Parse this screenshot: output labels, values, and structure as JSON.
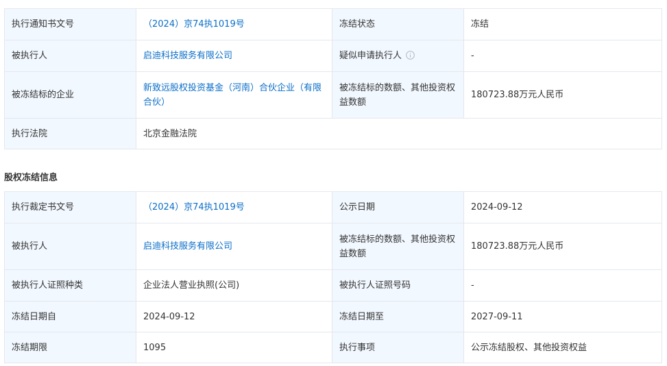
{
  "freeze_notice": {
    "row1": {
      "label_a": "执行通知书文号",
      "value_a": "（2024）京74执1019号",
      "label_b": "冻结状态",
      "value_b": "冻结"
    },
    "row2": {
      "label_a": "被执行人",
      "value_a": "启迪科技服务有限公司",
      "label_b": "疑似申请执行人",
      "value_b": "-"
    },
    "row3": {
      "label_a": "被冻结标的企业",
      "value_a": "新致远股权投资基金（河南）合伙企业（有限合伙）",
      "label_b": "被冻结标的数额、其他投资权益数额",
      "value_b": "180723.88万元人民币"
    },
    "row4": {
      "label_a": "执行法院",
      "value_a": "北京金融法院"
    }
  },
  "equity_freeze": {
    "title": "股权冻结信息",
    "row1": {
      "label_a": "执行裁定书文号",
      "value_a": "（2024）京74执1019号",
      "label_b": "公示日期",
      "value_b": "2024-09-12"
    },
    "row2": {
      "label_a": "被执行人",
      "value_a": "启迪科技服务有限公司",
      "label_b": "被冻结标的数额、其他投资权益数额",
      "value_b": "180723.88万元人民币"
    },
    "row3": {
      "label_a": "被执行人证照种类",
      "value_a": "企业法人营业执照(公司)",
      "label_b": "被执行人证照号码",
      "value_b": "-"
    },
    "row4": {
      "label_a": "冻结日期自",
      "value_a": "2024-09-12",
      "label_b": "冻结日期至",
      "value_b": "2027-09-11"
    },
    "row5": {
      "label_a": "冻结期限",
      "value_a": "1095",
      "label_b": "执行事项",
      "value_b": "公示冻结股权、其他投资权益"
    }
  },
  "icons": {
    "info": "info-circle-icon"
  },
  "colors": {
    "label_bg": "#f2f8ff",
    "link": "#0a6ec8",
    "border": "#e4e7ed"
  }
}
